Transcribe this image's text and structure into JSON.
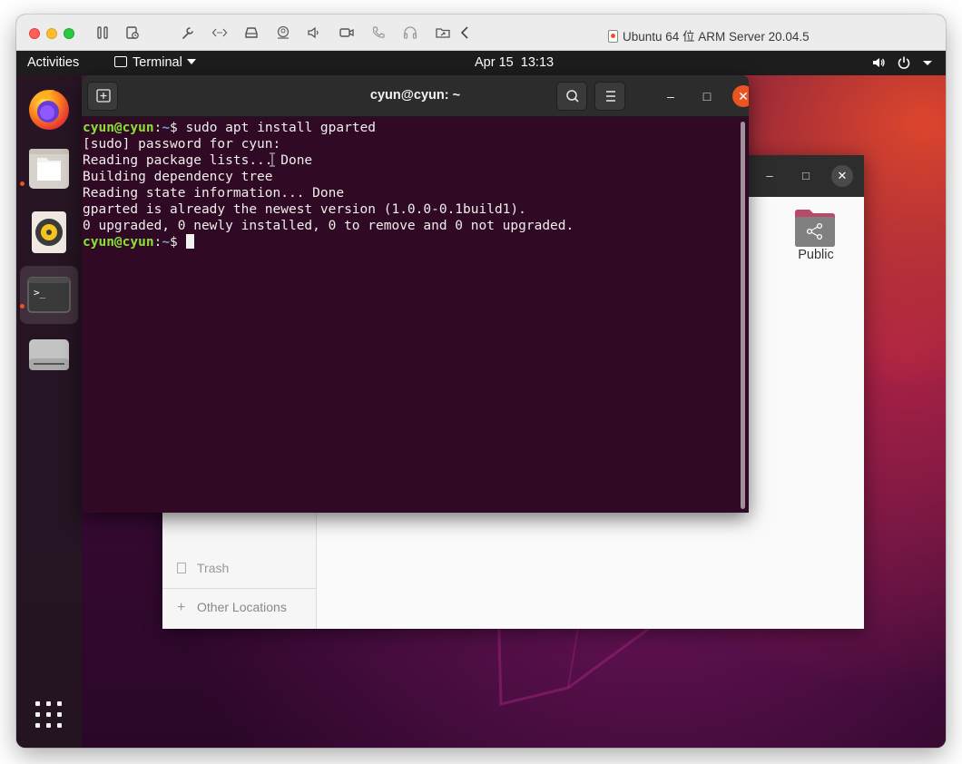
{
  "host_titlebar": {
    "title": "Ubuntu 64 位 ARM Server 20.04.5",
    "toolbar_icons": [
      "pause-icon",
      "snapshot-icon",
      "wrench-icon",
      "code-brackets-icon",
      "drive-icon",
      "camera-user-icon",
      "speaker-icon",
      "video-camera-icon",
      "phone-icon",
      "headphones-icon",
      "shared-folder-icon",
      "chevron-left-icon"
    ]
  },
  "gnome_topbar": {
    "activities": "Activities",
    "app_menu": "Terminal",
    "date": "Apr 15",
    "time": "13:13",
    "status_icons": [
      "volume-icon",
      "power-icon",
      "caret-down-icon"
    ]
  },
  "dock": {
    "items": [
      {
        "name": "firefox-icon",
        "running": false,
        "active": false
      },
      {
        "name": "files-icon",
        "running": true,
        "active": false
      },
      {
        "name": "rhythmbox-icon",
        "running": false,
        "active": false
      },
      {
        "name": "terminal-icon",
        "running": true,
        "active": true
      },
      {
        "name": "disk-drive-icon",
        "running": false,
        "active": false
      }
    ],
    "show_apps": "app-grid-icon"
  },
  "files_window": {
    "controls": {
      "minimize": "–",
      "maximize": "□",
      "close": "✕"
    },
    "sidebar": {
      "trash": "Trash",
      "other_locations": "Other Locations"
    },
    "folders": [
      {
        "name": "Public",
        "icon": "share-folder-icon"
      }
    ]
  },
  "terminal": {
    "title": "cyun@cyun: ~",
    "controls": {
      "minimize": "–",
      "maximize": "□",
      "close": "✕"
    },
    "prompt_user": "cyun@cyun",
    "prompt_path": "~",
    "prompt_sep": ":",
    "prompt_symbol": "$ ",
    "command": "sudo apt install gparted",
    "output": [
      "[sudo] password for cyun:",
      "Reading package lists... Done",
      "Building dependency tree",
      "Reading state information... Done",
      "gparted is already the newest version (1.0.0-0.1build1).",
      "0 upgraded, 0 newly installed, 0 to remove and 0 not upgraded."
    ]
  },
  "colors": {
    "terminal_bg": "#300a24",
    "prompt_user": "#8ae234",
    "prompt_path": "#729fcf",
    "ubuntu_orange": "#e95420"
  }
}
